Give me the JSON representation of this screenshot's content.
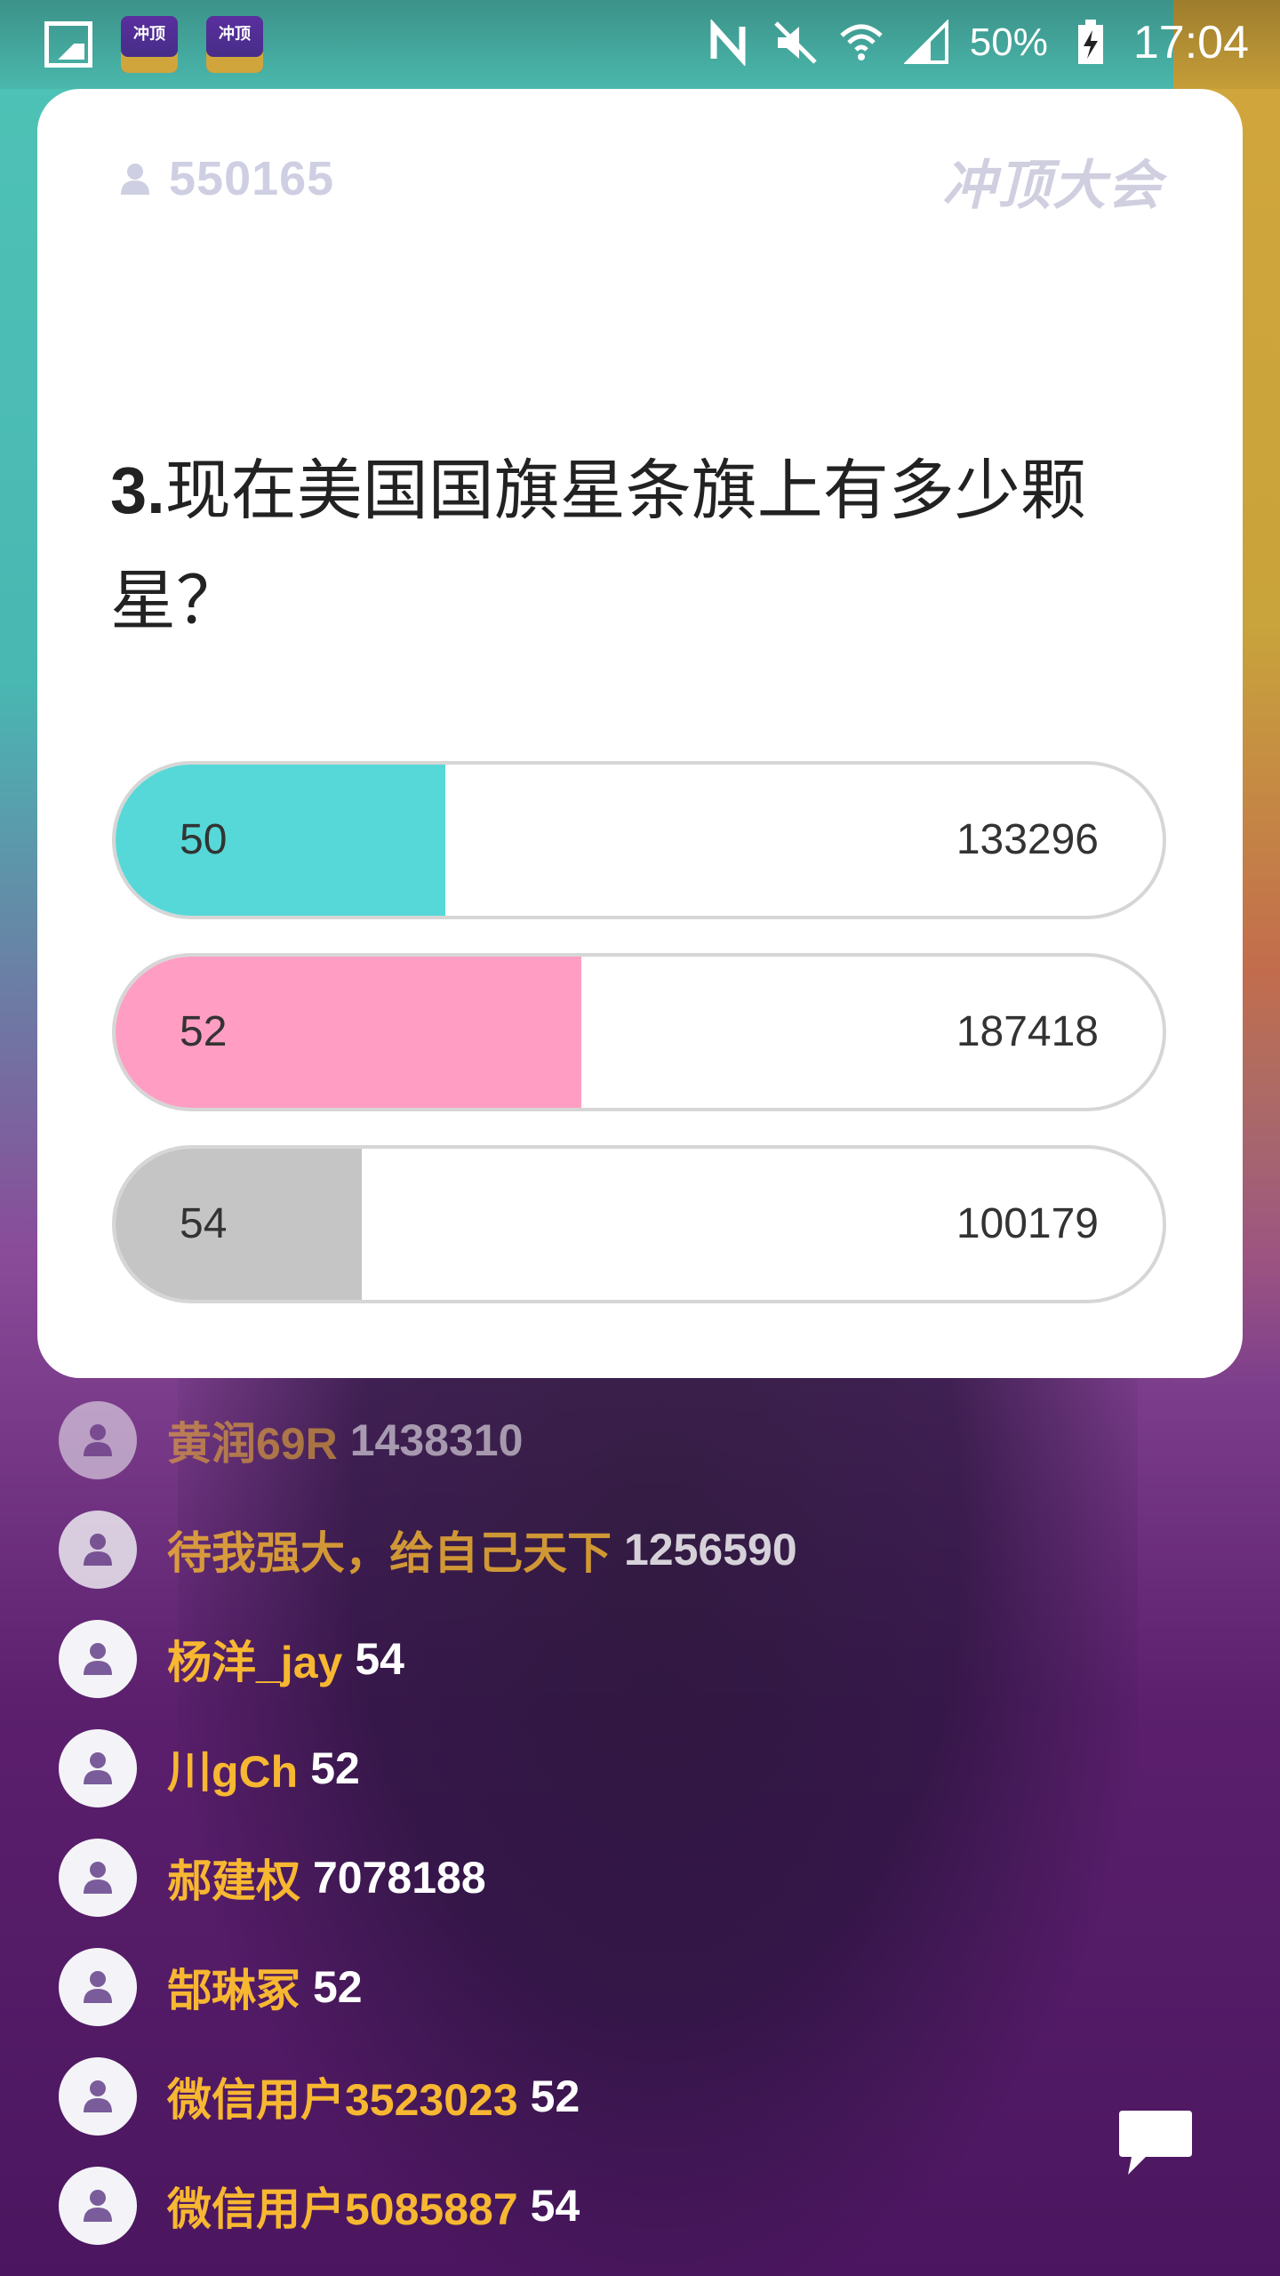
{
  "status_bar": {
    "battery": "50%",
    "time": "17:04",
    "icons": [
      "gallery-icon",
      "app-icon",
      "app-icon",
      "nfc-icon",
      "mute-icon",
      "wifi-icon",
      "signal-icon",
      "battery-charging-icon"
    ],
    "app_icon_text": "冲顶"
  },
  "card": {
    "viewer_count": "550165",
    "brand": "冲顶大会",
    "question_number": "3.",
    "question_text": "现在美国国旗星条旗上有多少颗星？",
    "options": [
      {
        "label": "50",
        "count": "133296",
        "fill_ratio": 0.315,
        "color": "#55d8d7"
      },
      {
        "label": "52",
        "count": "187418",
        "fill_ratio": 0.445,
        "color": "#ff9dc2"
      },
      {
        "label": "54",
        "count": "100179",
        "fill_ratio": 0.235,
        "color": "#c5c5c5"
      }
    ]
  },
  "comments": [
    {
      "name": "黄润69R",
      "answer": "1438310"
    },
    {
      "name": "待我强大，给自己天下",
      "answer": "1256590"
    },
    {
      "name": "杨洋_jay",
      "answer": "54"
    },
    {
      "name": "川gCh",
      "answer": "52"
    },
    {
      "name": "郝建权",
      "answer": "7078188"
    },
    {
      "name": "郜琳冢",
      "answer": "52"
    },
    {
      "name": "微信用户3523023",
      "answer": "52"
    },
    {
      "name": "微信用户5085887",
      "answer": "54"
    }
  ],
  "colors": {
    "comment_name": "#f7b731",
    "card_bg": "#ffffff"
  }
}
